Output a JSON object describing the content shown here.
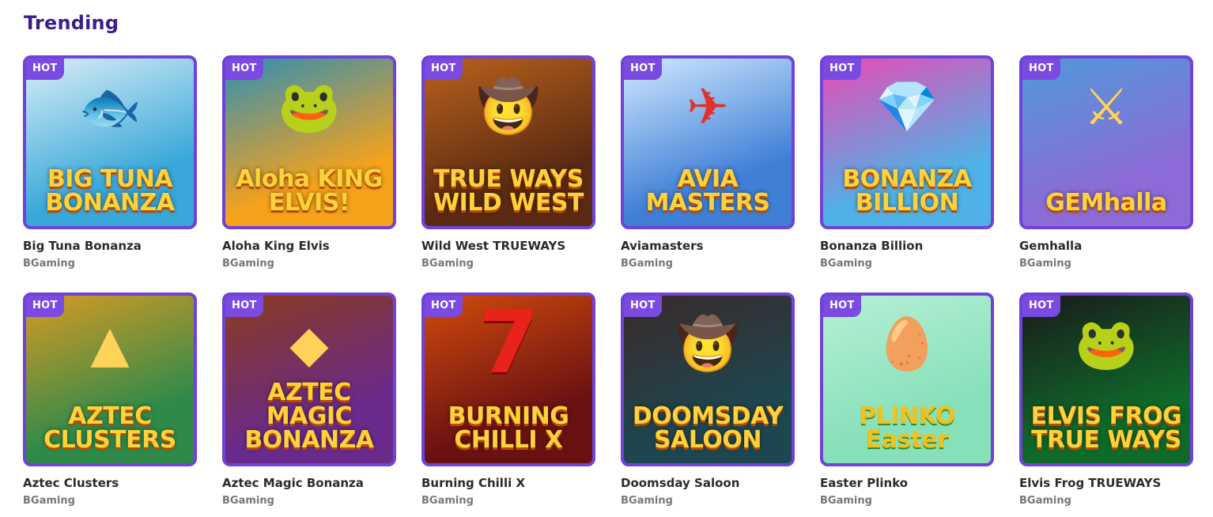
{
  "section": {
    "title": "Trending"
  },
  "games": [
    {
      "title": "Big Tuna Bonanza",
      "provider": "BGaming",
      "badge": "HOT",
      "art_text": "BIG TUNA BONANZA",
      "icon": "fish-icon",
      "bg": "#38a7d9",
      "bg2": "#d8eef6"
    },
    {
      "title": "Aloha King Elvis",
      "provider": "BGaming",
      "badge": "HOT",
      "art_text": "Aloha KING ELVIS!",
      "icon": "frog-icon",
      "bg": "#f6a21b",
      "bg2": "#2f8fb5"
    },
    {
      "title": "Wild West TRUEWAYS",
      "provider": "BGaming",
      "badge": "HOT",
      "art_text": "TRUE WAYS WILD WEST",
      "icon": "cowgirl-icon",
      "bg": "#5a2a12",
      "bg2": "#b9621c"
    },
    {
      "title": "Aviamasters",
      "provider": "BGaming",
      "badge": "HOT",
      "art_text": "AVIA MASTERS",
      "icon": "plane-icon",
      "bg": "#3f7fd6",
      "bg2": "#cfe8ff"
    },
    {
      "title": "Bonanza Billion",
      "provider": "BGaming",
      "badge": "HOT",
      "art_text": "BONANZA BILLION",
      "icon": "gem-icon",
      "bg": "#4fb2e6",
      "bg2": "#e84bb6"
    },
    {
      "title": "Gemhalla",
      "provider": "BGaming",
      "badge": "HOT",
      "art_text": "GEMhalla",
      "icon": "viking-icon",
      "bg": "#8c6bd6",
      "bg2": "#4f9ad8"
    },
    {
      "title": "Aztec Clusters",
      "provider": "BGaming",
      "badge": "HOT",
      "art_text": "AZTEC CLUSTERS",
      "icon": "temple-icon",
      "bg": "#2f8a4a",
      "bg2": "#d79a23"
    },
    {
      "title": "Aztec Magic Bonanza",
      "provider": "BGaming",
      "badge": "HOT",
      "art_text": "AZTEC MAGIC BONANZA",
      "icon": "mask-icon",
      "bg": "#6a2a8c",
      "bg2": "#8a3b1d"
    },
    {
      "title": "Burning Chilli X",
      "provider": "BGaming",
      "badge": "HOT",
      "art_text": "BURNING CHILLI X",
      "icon": "seven-icon",
      "bg": "#6a1212",
      "bg2": "#d14a0c"
    },
    {
      "title": "Doomsday Saloon",
      "provider": "BGaming",
      "badge": "HOT",
      "art_text": "DOOMSDAY SALOON",
      "icon": "cowboy-icon",
      "bg": "#1e4650",
      "bg2": "#3a2a2a"
    },
    {
      "title": "Easter Plinko",
      "provider": "BGaming",
      "badge": "HOT",
      "art_text": "PLINKO Easter",
      "icon": "egg-icon",
      "bg": "#86e0b8",
      "bg2": "#b6f0d5"
    },
    {
      "title": "Elvis Frog TRUEWAYS",
      "provider": "BGaming",
      "badge": "HOT",
      "art_text": "ELVIS FROG TRUE WAYS",
      "icon": "frog-icon",
      "bg": "#0f6a2a",
      "bg2": "#1a1a1a"
    }
  ]
}
